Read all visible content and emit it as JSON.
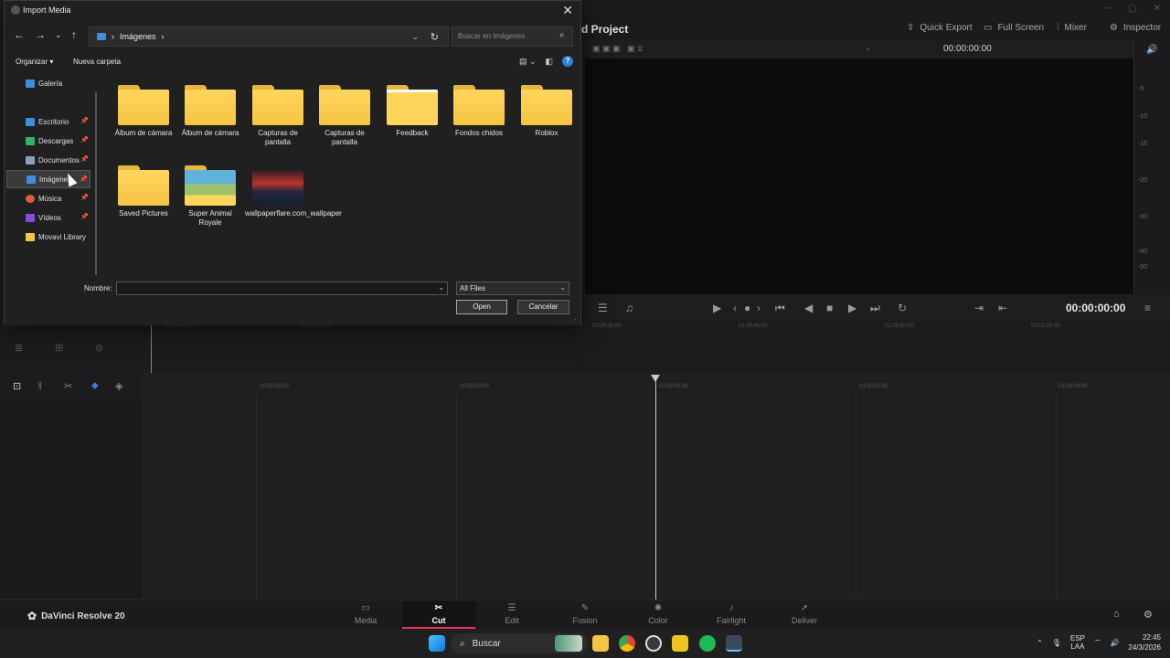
{
  "dialog": {
    "title": "Import Media",
    "close_glyph": "✕",
    "address": {
      "location": "Imágenes",
      "separator": "›"
    },
    "search_placeholder": "Buscar en Imágenes",
    "commands": {
      "organize": "Organizar ▾",
      "new_folder": "Nueva carpeta"
    },
    "sidebar": [
      {
        "label": "Galería",
        "icon": "gallery-icon",
        "color": "#3c8ee0",
        "pinned": false
      },
      {
        "label": "Escritorio",
        "icon": "desktop-icon",
        "color": "#3c8ee0",
        "pinned": true
      },
      {
        "label": "Descargas",
        "icon": "download-icon",
        "color": "#2fb36a",
        "pinned": true
      },
      {
        "label": "Documentos",
        "icon": "document-icon",
        "color": "#8aa0b8",
        "pinned": true
      },
      {
        "label": "Imágenes",
        "icon": "pictures-icon",
        "color": "#3c8ee0",
        "pinned": true,
        "selected": true
      },
      {
        "label": "Música",
        "icon": "music-icon",
        "color": "#e05a3c",
        "pinned": true
      },
      {
        "label": "Vídeos",
        "icon": "videos-icon",
        "color": "#8a4ce0",
        "pinned": true
      },
      {
        "label": "Movavi Library",
        "icon": "folder-icon",
        "color": "#f5c443",
        "pinned": false
      }
    ],
    "files": [
      {
        "label": "Álbum de cámara",
        "kind": "folder"
      },
      {
        "label": "Álbum de cámara",
        "kind": "folder"
      },
      {
        "label": "Capturas de pantalla",
        "kind": "folder"
      },
      {
        "label": "Capturas de pantalla",
        "kind": "folder"
      },
      {
        "label": "Feedback",
        "kind": "folder"
      },
      {
        "label": "Fondos chidos",
        "kind": "folder"
      },
      {
        "label": "Roblox",
        "kind": "folder"
      },
      {
        "label": "Saved Pictures",
        "kind": "folder"
      },
      {
        "label": "Super Animal Royale",
        "kind": "folder-preview"
      },
      {
        "label": "wallpaperflare.com_wallpaper",
        "kind": "image"
      }
    ],
    "filename_label": "Nombre:",
    "filename_value": "",
    "filter_value": "All Files",
    "open_label": "Open",
    "cancel_label": "Cancelar"
  },
  "resolve": {
    "project_title": "d Project",
    "header_buttons": [
      "Quick Export",
      "Full Screen",
      "Mixer",
      "Inspector"
    ],
    "timecode_top": "00:00:00:00",
    "timecode_main": "00:00:00:00",
    "meter_ticks": [
      "-5",
      "-10",
      "-15",
      "-20",
      "-30",
      "-40",
      "-50"
    ],
    "ruler_top": [
      "01:00:30:00",
      "01:00:40:00",
      "01:00:50:00",
      "01:01:00:00"
    ],
    "ruler_left": [
      "01:00:00:00",
      "01:00:10:00"
    ],
    "timeline_ruler": [
      "00:59:56:00",
      "00:59:58:00",
      "01:00:00:00",
      "01:00:02:00",
      "01:00:04:00"
    ],
    "brand": "DaVinci Resolve 20",
    "pages": [
      {
        "label": "Media",
        "icon": "▭"
      },
      {
        "label": "Cut",
        "icon": "✂",
        "active": true
      },
      {
        "label": "Edit",
        "icon": "☰"
      },
      {
        "label": "Fusion",
        "icon": "✎"
      },
      {
        "label": "Color",
        "icon": "✺"
      },
      {
        "label": "Fairlight",
        "icon": "♪"
      },
      {
        "label": "Deliver",
        "icon": "➚"
      }
    ]
  },
  "taskbar": {
    "search_label": "Buscar",
    "lang_line1": "ESP",
    "lang_line2": "LAA",
    "time": "22:45",
    "date": "24/3/2026"
  }
}
